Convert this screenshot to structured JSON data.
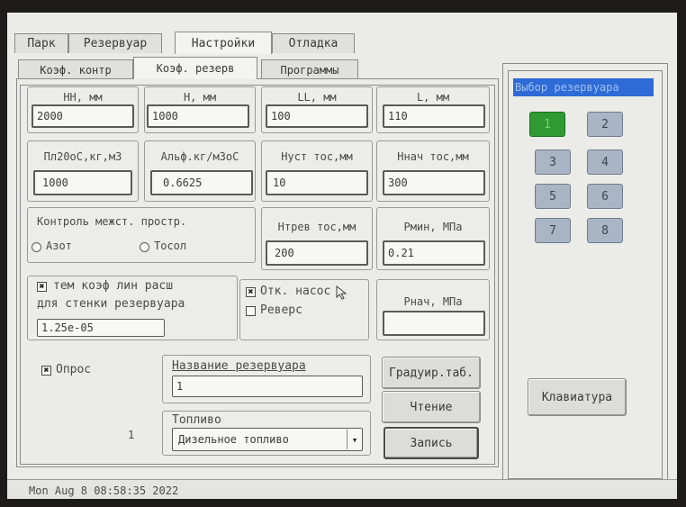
{
  "top_tabs": [
    "Парк",
    "Резервуар",
    "Настройки",
    "Отладка"
  ],
  "sub_tabs": [
    "Коэф. контр",
    "Коэф. резерв",
    "Программы"
  ],
  "fields": {
    "hn": {
      "label": "HH, мм",
      "value": "2000"
    },
    "h": {
      "label": "H, мм",
      "value": "1000"
    },
    "ll": {
      "label": "LL, мм",
      "value": "100"
    },
    "l": {
      "label": "L, мм",
      "value": "110"
    },
    "pl": {
      "label": "Пл20оС,кг,м3",
      "value": "1000"
    },
    "alf": {
      "label": "Альф.кг/м3оС",
      "value": "0.6625"
    },
    "nust": {
      "label": "Нуст тос,мм",
      "value": "10"
    },
    "nnach": {
      "label": "Ннач тос,мм",
      "value": "300"
    },
    "ntrev": {
      "label": "Нтрев тос,мм",
      "value": "200"
    },
    "pmin": {
      "label": "Рмин, МПа",
      "value": "0.21"
    },
    "pnach": {
      "label": "Рнач, МПа",
      "value": ""
    }
  },
  "control": {
    "label": "Контроль межст. простр.",
    "opt1": "Азот",
    "opt2": "Тосол"
  },
  "temp_coef": {
    "check": "✖",
    "line1": "тем коэф лин расш",
    "line2": "для стенки резервуара",
    "value": "1.25e-05"
  },
  "pump": {
    "check1": "✖",
    "label1": "Отк. насос",
    "label2": "Реверс"
  },
  "poll": {
    "check": "✖",
    "label": "Опрос"
  },
  "tank_name": {
    "label": "Название резервуара",
    "value": "1"
  },
  "fuel": {
    "label": "Топливо",
    "value": "Дизельное топливо",
    "arrow": "▾"
  },
  "left_number": "1",
  "buttons": {
    "calib": "Градуир.таб.",
    "read": "Чтение",
    "write": "Запись",
    "keyboard": "Клавиатура"
  },
  "tank_select": {
    "title": "Выбор резервуара",
    "numbers": [
      "1",
      "2",
      "3",
      "4",
      "5",
      "6",
      "7",
      "8"
    ],
    "selected": "1"
  },
  "status": "Mon Aug 8 08:58:35 2022"
}
